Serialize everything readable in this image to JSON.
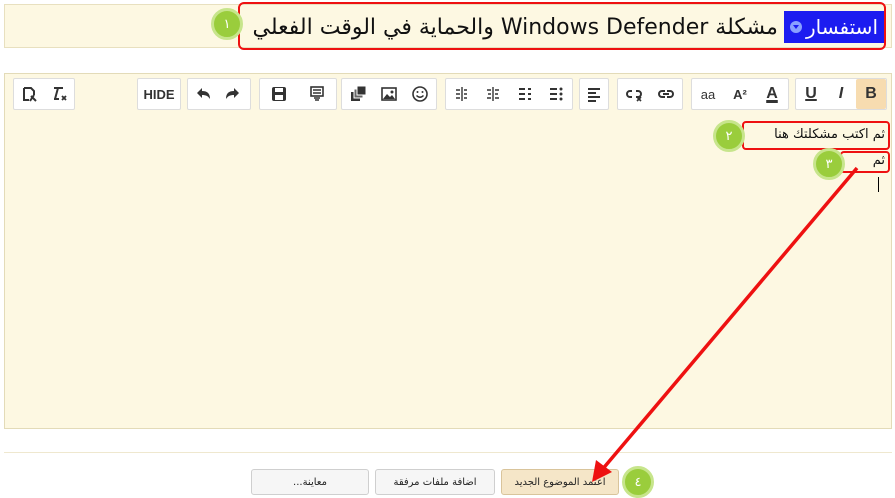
{
  "title": {
    "prefix": "استفسار",
    "text": "مشكلة  Windows Defender والحماية في الوقت الفعلي"
  },
  "steps": [
    "١",
    "٢",
    "٣",
    "٤"
  ],
  "toolbar": {
    "hide_label": "HIDE",
    "bold_label": "B",
    "italic_label": "I",
    "underline_label": "U",
    "font_color_label": "A",
    "superscript_label": "A²",
    "font_size_label": "aa"
  },
  "editor": {
    "line1": "ثم اكتب مشكلتك هنا",
    "line2": "ثم"
  },
  "buttons": {
    "submit": "اعتمد الموضوع الجديد",
    "attach": "اضافة ملفات مرفقة",
    "preview": "معاينة..."
  },
  "colors": {
    "annotation": "#ee1111",
    "badge": "#9acd3c",
    "prefix_bg": "#1c1cf0",
    "editor_bg": "#fdf8e2"
  }
}
